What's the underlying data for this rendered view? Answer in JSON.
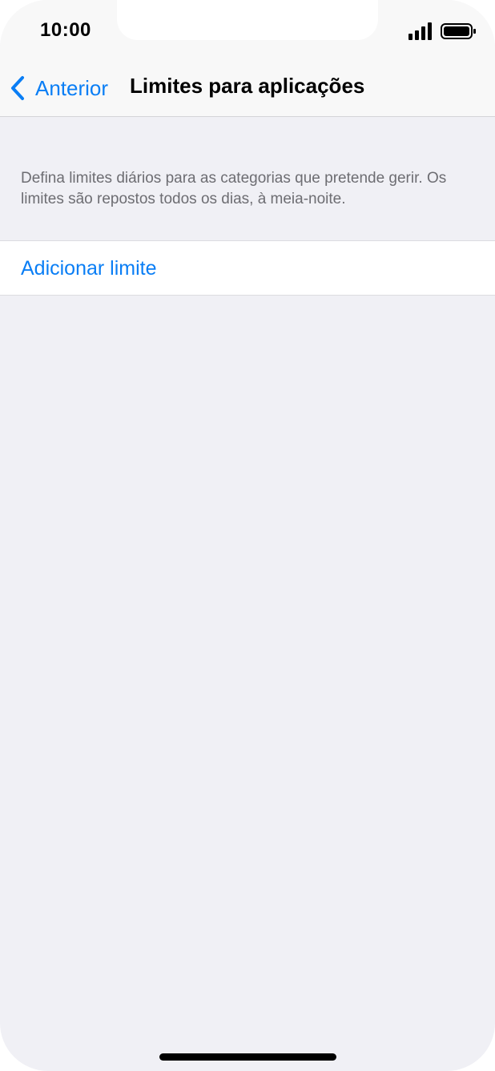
{
  "status_bar": {
    "time": "10:00",
    "icons": [
      "signal-icon",
      "battery-icon"
    ]
  },
  "nav": {
    "back_label": "Anterior",
    "title": "Limites para aplicações",
    "back_icon": "chevron-left-icon"
  },
  "main": {
    "description": "Defina limites diários para as categorias que pretende gerir. Os limites são repostos todos os dias, à meia-noite.",
    "add_limit_label": "Adicionar limite"
  },
  "colors": {
    "accent": "#0a7ef5",
    "background": "#f0f0f5",
    "secondary_text": "#6d6d72"
  }
}
